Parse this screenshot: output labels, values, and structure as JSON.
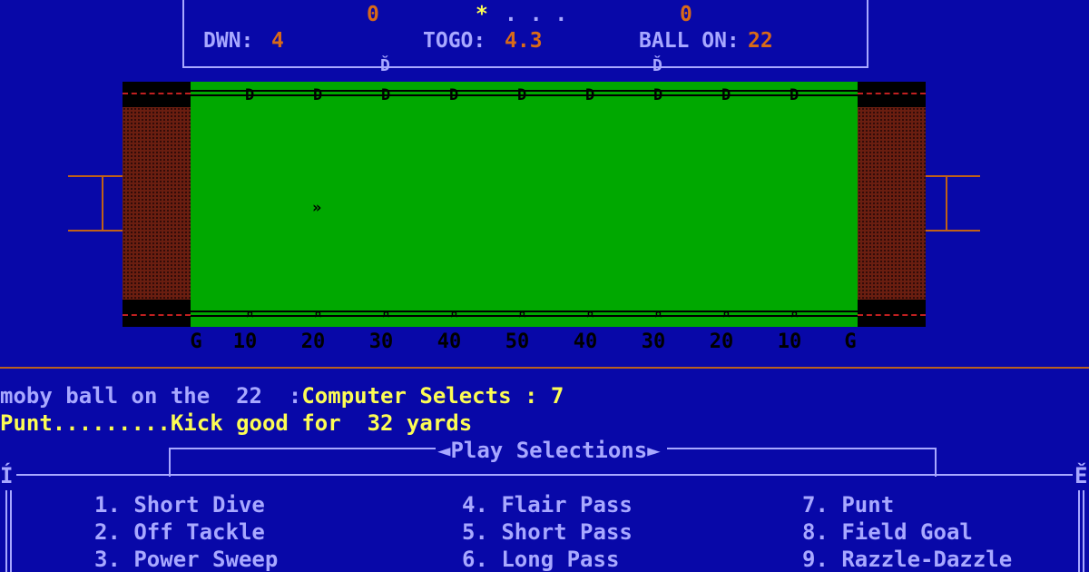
{
  "scoreboard": {
    "home_score": "0",
    "away_score": "0",
    "possession_indicator": "*",
    "clock_dots": ". . .",
    "down_label": "DWN:",
    "down_value": "4",
    "togo_label": "TOGO:",
    "togo_value": "4.3",
    "ball_on_label": "BALL ON:",
    "ball_on_value": "22"
  },
  "field": {
    "marker_glyph": "Ď",
    "top_player_glyph": "D",
    "bottom_player_glyph": "¤",
    "ball_glyph": "»",
    "yard_labels": [
      "G",
      "10",
      "20",
      "30",
      "40",
      "50",
      "40",
      "30",
      "20",
      "10",
      "G"
    ]
  },
  "messages": {
    "line1_prefix": "moby ball on the  22  :",
    "line1_suffix": "Computer Selects : 7",
    "line2": "Punt.........Kick good for  32 yards"
  },
  "play_box": {
    "left_corner": "Í",
    "right_corner": "Ě",
    "title": "◄Play Selections►",
    "plays": [
      "1. Short Dive",
      "2. Off Tackle",
      "3. Power Sweep",
      "4. Flair Pass",
      "5. Short Pass",
      "6. Long Pass",
      "7. Punt",
      "8. Field Goal",
      "9. Razzle-Dazzle"
    ]
  },
  "colors": {
    "background": "#0808a8",
    "field_green": "#00a800",
    "text_light_blue": "#a8a8ff",
    "text_yellow": "#fcfc54",
    "text_orange": "#d86a18"
  }
}
